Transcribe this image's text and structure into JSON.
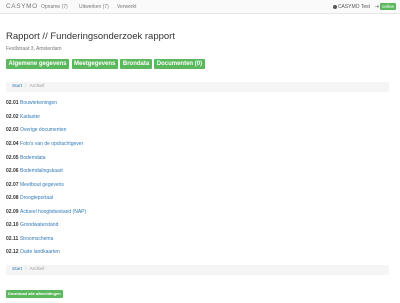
{
  "navbar": {
    "brand": "CASYMO",
    "items": [
      {
        "label": "Opname (7)"
      },
      {
        "label": "Uitwerken (7)"
      },
      {
        "label": "Verwerkt"
      }
    ],
    "user": "CASYMO Test",
    "status": "online"
  },
  "page": {
    "title": "Rapport // Funderingsonderzoek rapport",
    "address": "Festlstraat 3, Amsterdam"
  },
  "tabs": [
    {
      "label": "Algemene gegevens"
    },
    {
      "label": "Meetgegevens"
    },
    {
      "label": "Brondata"
    },
    {
      "label": "Documenten (0)"
    }
  ],
  "breadcrumb": {
    "start": "Start",
    "separator": "/",
    "current": "Archief"
  },
  "items": [
    {
      "code": "02.01",
      "label": "Bouwtekeningen"
    },
    {
      "code": "02.02",
      "label": "Kadaster"
    },
    {
      "code": "02.03",
      "label": "Overige documenten"
    },
    {
      "code": "02.04",
      "label": "Foto's van de opdrachtgever"
    },
    {
      "code": "02.05",
      "label": "Bodemdata"
    },
    {
      "code": "02.06",
      "label": "Bodemdalingskaart"
    },
    {
      "code": "02.07",
      "label": "Meetbout gegevens"
    },
    {
      "code": "02.08",
      "label": "Droogteportaal"
    },
    {
      "code": "02.09",
      "label": "Actueel hoogtebestand (NAP)"
    },
    {
      "code": "02.10",
      "label": "Grondwaterstand"
    },
    {
      "code": "02.11",
      "label": "Stroomschema"
    },
    {
      "code": "02.12",
      "label": "Oude landkaarten"
    }
  ],
  "download_label": "Download alle afbeeldingen",
  "colors": {
    "accent": "#5cb85c",
    "link": "#337ab7"
  },
  "icons": {
    "user": "user-icon",
    "logout": "logout-icon"
  }
}
